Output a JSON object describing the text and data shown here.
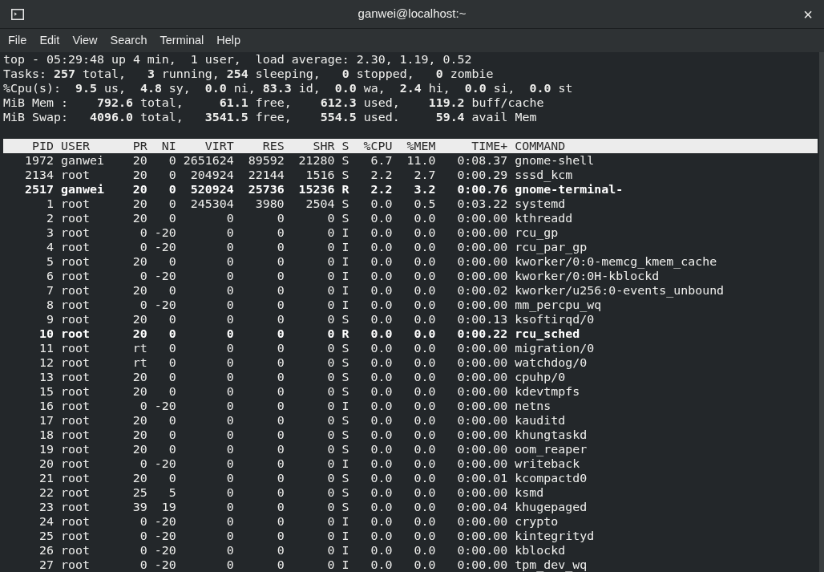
{
  "window": {
    "title": "ganwei@localhost:~",
    "close": "×"
  },
  "menu": [
    "File",
    "Edit",
    "View",
    "Search",
    "Terminal",
    "Help"
  ],
  "summary": [
    "top - 05:29:48 up 4 min,  1 user,  load average: 2.30, 1.19, 0.52",
    "Tasks: **257** total,   **3** running, **254** sleeping,   **0** stopped,   **0** zombie",
    "%Cpu(s):  **9.5** us,  **4.8** sy,  **0.0** ni, **83.3** id,  **0.0** wa,  **2.4** hi,  **0.0** si,  **0.0** st",
    "MiB Mem :    **792.6** total,     **61.1** free,    **612.3** used,    **119.2** buff/cache",
    "MiB Swap:   **4096.0** total,   **3541.5** free,    **554.5** used.     **59.4** avail Mem"
  ],
  "table": {
    "columns": [
      "PID",
      "USER",
      "PR",
      "NI",
      "VIRT",
      "RES",
      "SHR",
      "S",
      "%CPU",
      "%MEM",
      "TIME+",
      "COMMAND"
    ],
    "rows": [
      {
        "bold": false,
        "cells": [
          "1972",
          "ganwei",
          "20",
          "0",
          "2651624",
          "89592",
          "21280",
          "S",
          "6.7",
          "11.0",
          "0:08.37",
          "gnome-shell"
        ]
      },
      {
        "bold": false,
        "cells": [
          "2134",
          "root",
          "20",
          "0",
          "204924",
          "22144",
          "1516",
          "S",
          "2.2",
          "2.7",
          "0:00.29",
          "sssd_kcm"
        ]
      },
      {
        "bold": true,
        "cells": [
          "2517",
          "ganwei",
          "20",
          "0",
          "520924",
          "25736",
          "15236",
          "R",
          "2.2",
          "3.2",
          "0:00.76",
          "gnome-terminal-"
        ]
      },
      {
        "bold": false,
        "cells": [
          "1",
          "root",
          "20",
          "0",
          "245304",
          "3980",
          "2504",
          "S",
          "0.0",
          "0.5",
          "0:03.22",
          "systemd"
        ]
      },
      {
        "bold": false,
        "cells": [
          "2",
          "root",
          "20",
          "0",
          "0",
          "0",
          "0",
          "S",
          "0.0",
          "0.0",
          "0:00.00",
          "kthreadd"
        ]
      },
      {
        "bold": false,
        "cells": [
          "3",
          "root",
          "0",
          "-20",
          "0",
          "0",
          "0",
          "I",
          "0.0",
          "0.0",
          "0:00.00",
          "rcu_gp"
        ]
      },
      {
        "bold": false,
        "cells": [
          "4",
          "root",
          "0",
          "-20",
          "0",
          "0",
          "0",
          "I",
          "0.0",
          "0.0",
          "0:00.00",
          "rcu_par_gp"
        ]
      },
      {
        "bold": false,
        "cells": [
          "5",
          "root",
          "20",
          "0",
          "0",
          "0",
          "0",
          "I",
          "0.0",
          "0.0",
          "0:00.00",
          "kworker/0:0-memcg_kmem_cache"
        ]
      },
      {
        "bold": false,
        "cells": [
          "6",
          "root",
          "0",
          "-20",
          "0",
          "0",
          "0",
          "I",
          "0.0",
          "0.0",
          "0:00.00",
          "kworker/0:0H-kblockd"
        ]
      },
      {
        "bold": false,
        "cells": [
          "7",
          "root",
          "20",
          "0",
          "0",
          "0",
          "0",
          "I",
          "0.0",
          "0.0",
          "0:00.02",
          "kworker/u256:0-events_unbound"
        ]
      },
      {
        "bold": false,
        "cells": [
          "8",
          "root",
          "0",
          "-20",
          "0",
          "0",
          "0",
          "I",
          "0.0",
          "0.0",
          "0:00.00",
          "mm_percpu_wq"
        ]
      },
      {
        "bold": false,
        "cells": [
          "9",
          "root",
          "20",
          "0",
          "0",
          "0",
          "0",
          "S",
          "0.0",
          "0.0",
          "0:00.13",
          "ksoftirqd/0"
        ]
      },
      {
        "bold": true,
        "cells": [
          "10",
          "root",
          "20",
          "0",
          "0",
          "0",
          "0",
          "R",
          "0.0",
          "0.0",
          "0:00.22",
          "rcu_sched"
        ]
      },
      {
        "bold": false,
        "cells": [
          "11",
          "root",
          "rt",
          "0",
          "0",
          "0",
          "0",
          "S",
          "0.0",
          "0.0",
          "0:00.00",
          "migration/0"
        ]
      },
      {
        "bold": false,
        "cells": [
          "12",
          "root",
          "rt",
          "0",
          "0",
          "0",
          "0",
          "S",
          "0.0",
          "0.0",
          "0:00.00",
          "watchdog/0"
        ]
      },
      {
        "bold": false,
        "cells": [
          "13",
          "root",
          "20",
          "0",
          "0",
          "0",
          "0",
          "S",
          "0.0",
          "0.0",
          "0:00.00",
          "cpuhp/0"
        ]
      },
      {
        "bold": false,
        "cells": [
          "15",
          "root",
          "20",
          "0",
          "0",
          "0",
          "0",
          "S",
          "0.0",
          "0.0",
          "0:00.00",
          "kdevtmpfs"
        ]
      },
      {
        "bold": false,
        "cells": [
          "16",
          "root",
          "0",
          "-20",
          "0",
          "0",
          "0",
          "I",
          "0.0",
          "0.0",
          "0:00.00",
          "netns"
        ]
      },
      {
        "bold": false,
        "cells": [
          "17",
          "root",
          "20",
          "0",
          "0",
          "0",
          "0",
          "S",
          "0.0",
          "0.0",
          "0:00.00",
          "kauditd"
        ]
      },
      {
        "bold": false,
        "cells": [
          "18",
          "root",
          "20",
          "0",
          "0",
          "0",
          "0",
          "S",
          "0.0",
          "0.0",
          "0:00.00",
          "khungtaskd"
        ]
      },
      {
        "bold": false,
        "cells": [
          "19",
          "root",
          "20",
          "0",
          "0",
          "0",
          "0",
          "S",
          "0.0",
          "0.0",
          "0:00.00",
          "oom_reaper"
        ]
      },
      {
        "bold": false,
        "cells": [
          "20",
          "root",
          "0",
          "-20",
          "0",
          "0",
          "0",
          "I",
          "0.0",
          "0.0",
          "0:00.00",
          "writeback"
        ]
      },
      {
        "bold": false,
        "cells": [
          "21",
          "root",
          "20",
          "0",
          "0",
          "0",
          "0",
          "S",
          "0.0",
          "0.0",
          "0:00.01",
          "kcompactd0"
        ]
      },
      {
        "bold": false,
        "cells": [
          "22",
          "root",
          "25",
          "5",
          "0",
          "0",
          "0",
          "S",
          "0.0",
          "0.0",
          "0:00.00",
          "ksmd"
        ]
      },
      {
        "bold": false,
        "cells": [
          "23",
          "root",
          "39",
          "19",
          "0",
          "0",
          "0",
          "S",
          "0.0",
          "0.0",
          "0:00.04",
          "khugepaged"
        ]
      },
      {
        "bold": false,
        "cells": [
          "24",
          "root",
          "0",
          "-20",
          "0",
          "0",
          "0",
          "I",
          "0.0",
          "0.0",
          "0:00.00",
          "crypto"
        ]
      },
      {
        "bold": false,
        "cells": [
          "25",
          "root",
          "0",
          "-20",
          "0",
          "0",
          "0",
          "I",
          "0.0",
          "0.0",
          "0:00.00",
          "kintegrityd"
        ]
      },
      {
        "bold": false,
        "cells": [
          "26",
          "root",
          "0",
          "-20",
          "0",
          "0",
          "0",
          "I",
          "0.0",
          "0.0",
          "0:00.00",
          "kblockd"
        ]
      },
      {
        "bold": false,
        "cells": [
          "27",
          "root",
          "0",
          "-20",
          "0",
          "0",
          "0",
          "I",
          "0.0",
          "0.0",
          "0:00.00",
          "tpm_dev_wq"
        ]
      }
    ]
  }
}
